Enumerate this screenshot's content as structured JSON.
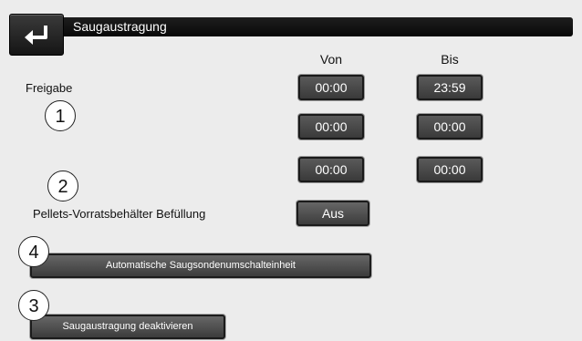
{
  "header": {
    "back_icon": "return-arrow-icon",
    "title": "Saugaustragung"
  },
  "schedule": {
    "label": "Freigabe",
    "col_von": "Von",
    "col_bis": "Bis",
    "rows": [
      {
        "von": "00:00",
        "bis": "23:59"
      },
      {
        "von": "00:00",
        "bis": "00:00"
      },
      {
        "von": "00:00",
        "bis": "00:00"
      }
    ]
  },
  "fill": {
    "label": "Pellets-Vorratsbehälter Befüllung",
    "value": "Aus"
  },
  "buttons": {
    "auto_switch": "Automatische Saugsondenumschalteinheit",
    "deactivate": "Saugaustragung deaktivieren"
  },
  "callouts": [
    "1",
    "2",
    "3",
    "4"
  ]
}
